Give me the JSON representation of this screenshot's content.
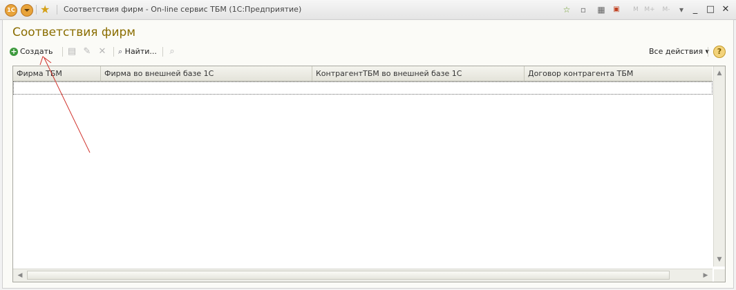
{
  "window": {
    "title": "Соответствия фирм - On-line сервис ТБМ  (1С:Предприятие)",
    "app_icon_label": "1С"
  },
  "page": {
    "title": "Соответствия фирм"
  },
  "toolbar": {
    "create_label": "Создать",
    "find_label": "Найти...",
    "all_actions_label": "Все действия ▾",
    "help_label": "?"
  },
  "table": {
    "columns": [
      "Фирма ТБМ",
      "Фирма во внешней базе 1С",
      "КонтрагентТБМ во внешней базе 1С",
      "Договор контрагента ТБМ"
    ],
    "rows": []
  },
  "colors": {
    "title": "#8a6d00",
    "annotation_arrow": "#d0302a",
    "create_icon": "#3d9a3d"
  },
  "icons": {
    "app": "1c-logo-icon",
    "main_menu": "main-menu-icon",
    "favorites": "star-icon",
    "create": "plus-circle-icon",
    "copy": "copy-icon",
    "edit": "pencil-icon",
    "delete": "delete-icon",
    "find": "magnifier-icon",
    "cancel_search": "cancel-search-icon"
  }
}
